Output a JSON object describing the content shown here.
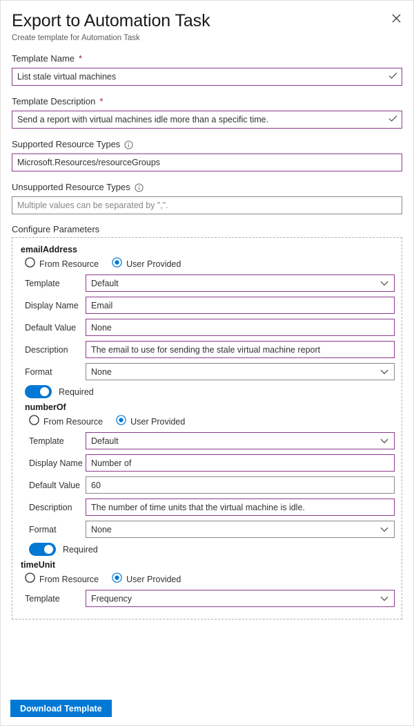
{
  "header": {
    "title": "Export to Automation Task",
    "subtitle": "Create template for Automation Task",
    "close_icon": "close-icon"
  },
  "fields": {
    "template_name": {
      "label": "Template Name",
      "required_marker": "*",
      "value": "List stale virtual machines",
      "placeholder": "",
      "validated": true,
      "border": "#8c3b8c"
    },
    "template_description": {
      "label": "Template Description",
      "required_marker": "*",
      "value": "Send a report with virtual machines idle more than a specific time.",
      "placeholder": "",
      "validated": true,
      "border": "#8c3b8c"
    },
    "supported_resource_types": {
      "label": "Supported Resource Types",
      "info_icon": "info-icon",
      "value": "Microsoft.Resources/resourceGroups",
      "placeholder": "",
      "validated": false,
      "border": "#8c3b8c"
    },
    "unsupported_resource_types": {
      "label": "Unsupported Resource Types",
      "info_icon": "info-icon",
      "value": "",
      "placeholder": "Multiple values can be separated by \",\".",
      "validated": false,
      "border": "#8a8886"
    }
  },
  "configure_parameters": {
    "section_label": "Configure Parameters",
    "radio_options": {
      "from_resource": "From Resource",
      "user_provided": "User Provided"
    },
    "row_labels": {
      "template": "Template",
      "display_name": "Display Name",
      "default_value": "Default Value",
      "description": "Description",
      "format": "Format"
    },
    "toggle_label": "Required",
    "parameters": [
      {
        "name": "emailAddress",
        "selected_source": "user_provided",
        "template": "Default",
        "display_name": "Email",
        "default_value": "None",
        "description": "The email to use for sending the stale virtual machine report",
        "format": "None",
        "required": true
      },
      {
        "name": "numberOf",
        "selected_source": "user_provided",
        "template": "Default",
        "display_name": "Number of",
        "default_value": "60",
        "description": "The number of time units that the virtual machine is idle.",
        "format": "None",
        "required": true
      },
      {
        "name": "timeUnit",
        "selected_source": "user_provided",
        "template": "Frequency"
      }
    ]
  },
  "footer": {
    "download_label": "Download Template"
  },
  "colors": {
    "accent_blue": "#0078d4",
    "field_purple": "#8c3b8c",
    "field_gray": "#8a8886",
    "required_red": "#a4262c"
  }
}
